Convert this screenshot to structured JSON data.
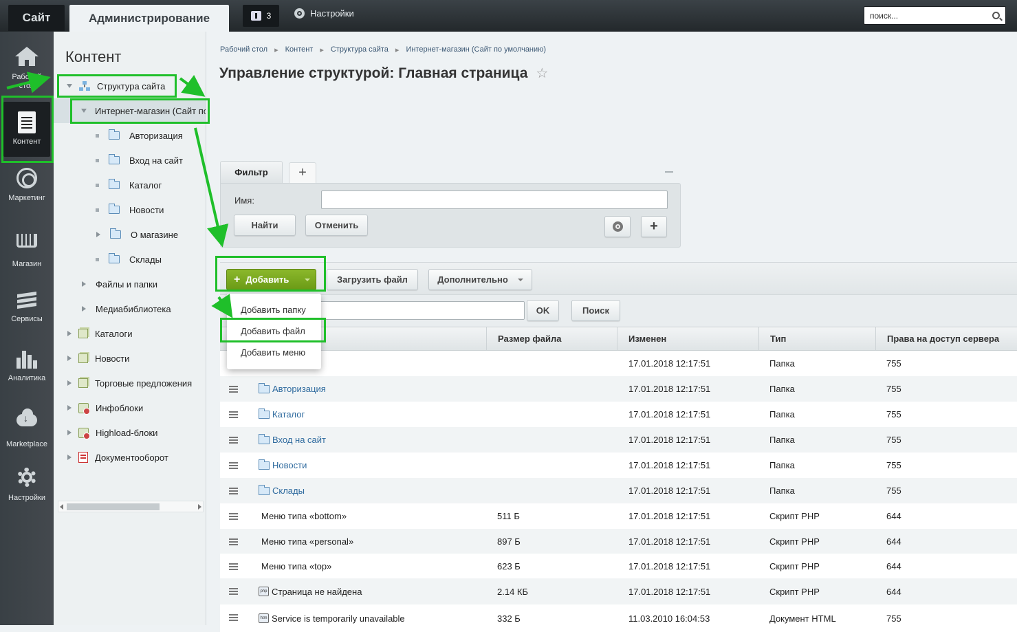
{
  "topbar": {
    "site_tab": "Сайт",
    "admin_tab": "Администрирование",
    "notifications_count": "3",
    "settings_label": "Настройки",
    "search_placeholder": "поиск..."
  },
  "leftnav": [
    {
      "label": "Рабочий стол",
      "icon": "home-icon"
    },
    {
      "label": "Контент",
      "icon": "document-icon",
      "active": true
    },
    {
      "label": "Маркетинг",
      "icon": "target-icon"
    },
    {
      "label": "Магазин",
      "icon": "basket-icon"
    },
    {
      "label": "Сервисы",
      "icon": "layers-icon"
    },
    {
      "label": "Аналитика",
      "icon": "bar-chart-icon"
    },
    {
      "label": "Marketplace",
      "icon": "cloud-download-icon"
    },
    {
      "label": "Настройки",
      "icon": "gear-icon"
    }
  ],
  "tree": {
    "title": "Контент",
    "items": [
      {
        "label": "Структура сайта"
      },
      {
        "label": "Интернет-магазин (Сайт по умолчанию)"
      },
      {
        "label": "Авторизация"
      },
      {
        "label": "Вход на сайт"
      },
      {
        "label": "Каталог"
      },
      {
        "label": "Новости"
      },
      {
        "label": "О магазине"
      },
      {
        "label": "Склады"
      },
      {
        "label": "Файлы и папки"
      },
      {
        "label": "Медиабиблиотека"
      },
      {
        "label": "Каталоги"
      },
      {
        "label": "Новости"
      },
      {
        "label": "Торговые предложения"
      },
      {
        "label": "Инфоблоки"
      },
      {
        "label": "Highload-блоки"
      },
      {
        "label": "Документооборот"
      }
    ]
  },
  "breadcrumb": [
    "Рабочий стол",
    "Контент",
    "Структура сайта",
    "Интернет-магазин (Сайт по умолчанию)"
  ],
  "page_title": "Управление структурой: Главная страница",
  "filter": {
    "tab_label": "Фильтр",
    "add_tab": "+",
    "name_label": "Имя:",
    "find_button": "Найти",
    "cancel_button": "Отменить"
  },
  "toolbar": {
    "add_button": "Добавить",
    "upload_button": "Загрузить файл",
    "more_button": "Дополнительно",
    "ok_button": "OK",
    "search_button": "Поиск"
  },
  "add_menu": [
    "Добавить папку",
    "Добавить файл",
    "Добавить меню"
  ],
  "table": {
    "columns": [
      "Размер файла",
      "Изменен",
      "Тип",
      "Права на доступ сервера"
    ],
    "rows": [
      {
        "name": "",
        "icon": "none",
        "size": "",
        "modified": "17.01.2018 12:17:51",
        "type": "Папка",
        "perm": "755"
      },
      {
        "name": "Авторизация",
        "icon": "folder",
        "size": "",
        "modified": "17.01.2018 12:17:51",
        "type": "Папка",
        "perm": "755"
      },
      {
        "name": "Каталог",
        "icon": "folder",
        "size": "",
        "modified": "17.01.2018 12:17:51",
        "type": "Папка",
        "perm": "755"
      },
      {
        "name": "Вход на сайт",
        "icon": "folder",
        "size": "",
        "modified": "17.01.2018 12:17:51",
        "type": "Папка",
        "perm": "755"
      },
      {
        "name": "Новости",
        "icon": "folder",
        "size": "",
        "modified": "17.01.2018 12:17:51",
        "type": "Папка",
        "perm": "755"
      },
      {
        "name": "Склады",
        "icon": "folder",
        "size": "",
        "modified": "17.01.2018 12:17:51",
        "type": "Папка",
        "perm": "755"
      },
      {
        "name": "Меню типа «bottom»",
        "icon": "none",
        "size": "511 Б",
        "modified": "17.01.2018 12:17:51",
        "type": "Скрипт PHP",
        "perm": "644"
      },
      {
        "name": "Меню типа «personal»",
        "icon": "none",
        "size": "897 Б",
        "modified": "17.01.2018 12:17:51",
        "type": "Скрипт PHP",
        "perm": "644"
      },
      {
        "name": "Меню типа «top»",
        "icon": "none",
        "size": "623 Б",
        "modified": "17.01.2018 12:17:51",
        "type": "Скрипт PHP",
        "perm": "644"
      },
      {
        "name": "Страница не найдена",
        "icon": "php",
        "size": "2.14 КБ",
        "modified": "17.01.2018 12:17:51",
        "type": "Скрипт PHP",
        "perm": "644"
      },
      {
        "name": "Service is temporarily unavailable",
        "icon": "html",
        "size": "332 Б",
        "modified": "11.03.2010 16:04:53",
        "type": "Документ HTML",
        "perm": "755"
      }
    ]
  },
  "colors": {
    "accent_green": "#6b9a16",
    "highlight": "#1fbf2a",
    "link": "#2e6a9e"
  }
}
